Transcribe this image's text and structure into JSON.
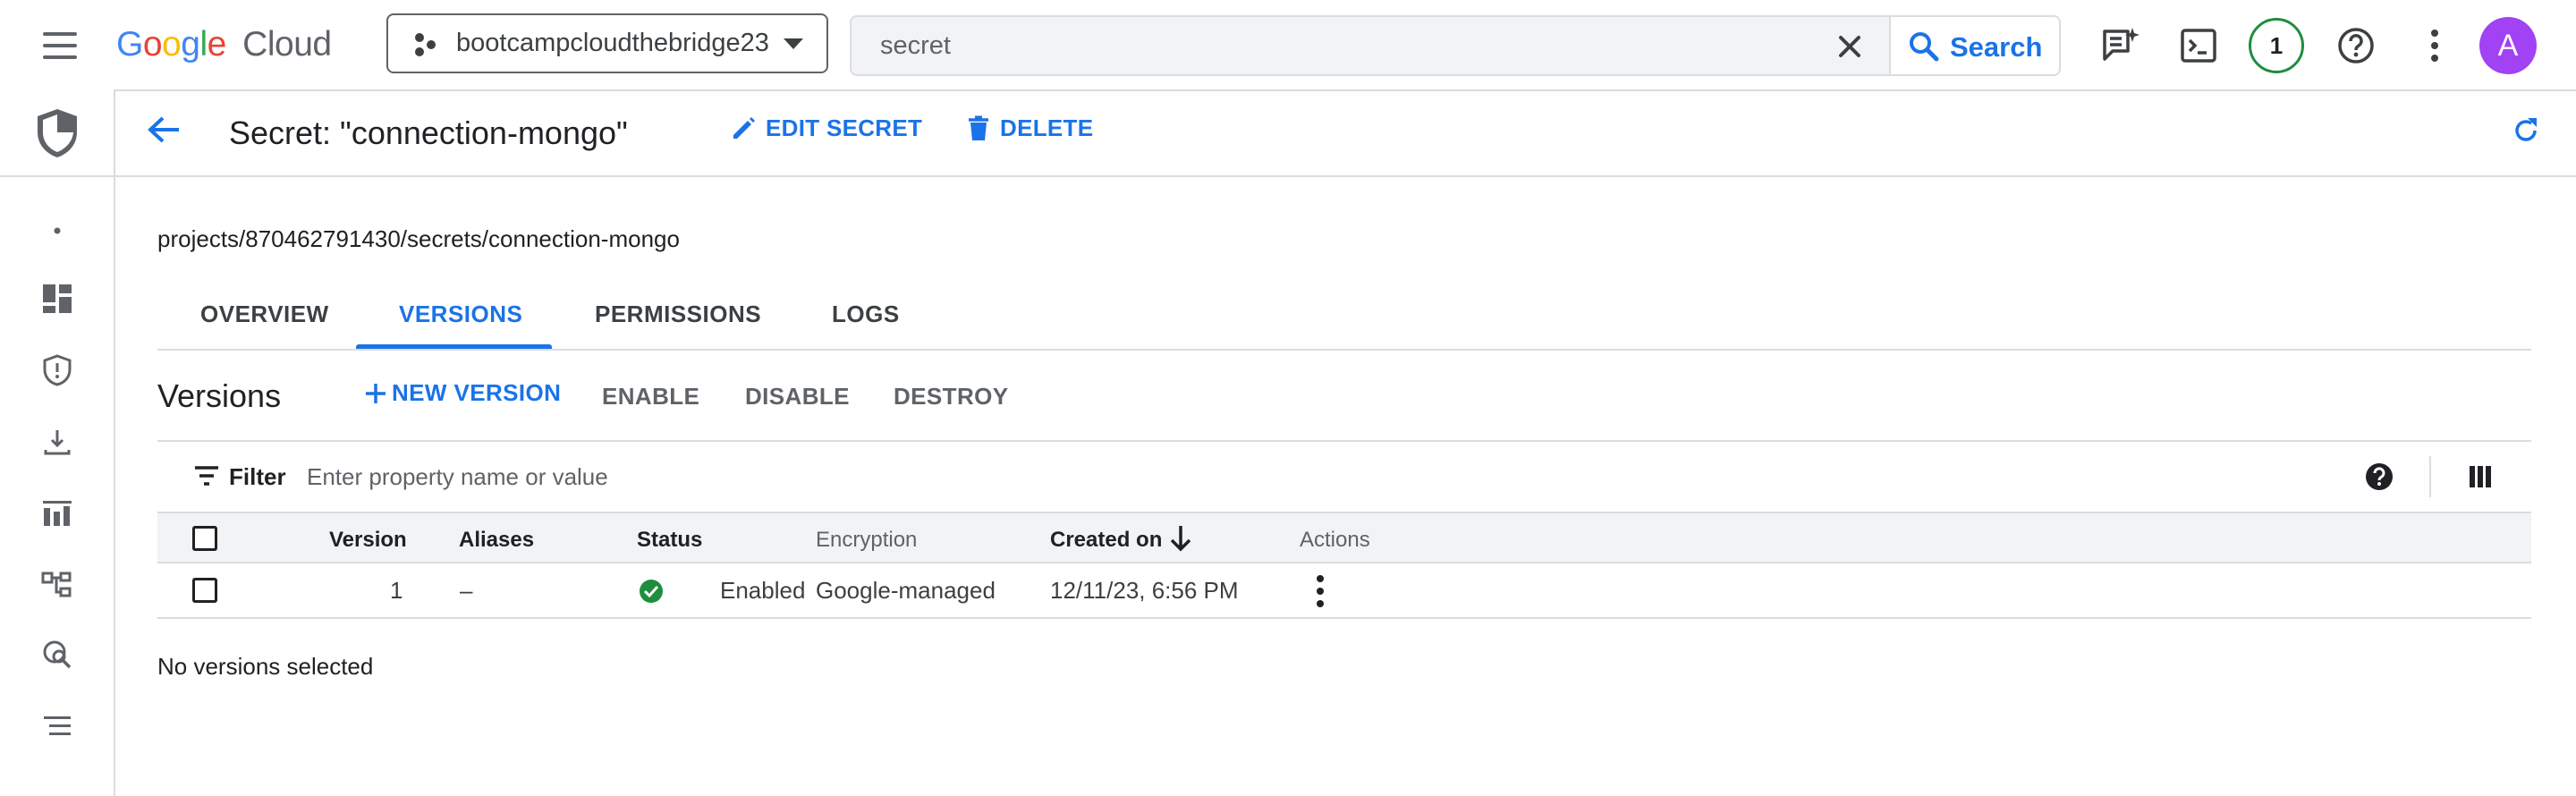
{
  "topbar": {
    "logo_google": "Google",
    "logo_cloud": "Cloud",
    "project": "bootcampcloudthebridge23",
    "search_value": "secret",
    "search_button": "Search",
    "notification_count": "1",
    "avatar_letter": "A",
    "avatar_color": "#a142f4"
  },
  "header": {
    "title": "Secret: \"connection-mongo\"",
    "edit_label": "EDIT SECRET",
    "delete_label": "DELETE"
  },
  "resource_path": "projects/870462791430/secrets/connection-mongo",
  "tabs": [
    {
      "label": "OVERVIEW"
    },
    {
      "label": "VERSIONS",
      "active": true
    },
    {
      "label": "PERMISSIONS"
    },
    {
      "label": "LOGS"
    }
  ],
  "versions": {
    "title": "Versions",
    "new_version": "NEW VERSION",
    "enable": "ENABLE",
    "disable": "DISABLE",
    "destroy": "DESTROY"
  },
  "filter": {
    "label": "Filter",
    "placeholder": "Enter property name or value"
  },
  "table": {
    "columns": [
      "Version",
      "Aliases",
      "Status",
      "Encryption",
      "Created on",
      "Actions"
    ],
    "rows": [
      {
        "version": "1",
        "aliases": "–",
        "status": "Enabled",
        "encryption": "Google-managed",
        "created_on": "12/11/23, 6:56 PM"
      }
    ]
  },
  "selection_status": "No versions selected",
  "colors": {
    "accent": "#1a73e8",
    "status_ok": "#1e8e3e",
    "text": "#202124"
  }
}
